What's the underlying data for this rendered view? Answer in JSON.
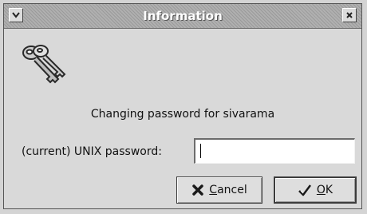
{
  "window": {
    "title": "Information",
    "menu_icon": "chevron-down-icon",
    "close_icon": "close-icon"
  },
  "dialog": {
    "icon": "keys-icon",
    "message": "Changing password for sivarama",
    "prompt_label": "(current) UNIX password:",
    "password_value": ""
  },
  "buttons": {
    "cancel_label": "Cancel",
    "cancel_icon": "cross-icon",
    "ok_label": "OK",
    "ok_icon": "checkmark-icon"
  },
  "colors": {
    "titlebar": "#a6a6a6",
    "dialog_bg": "#d9d9d9",
    "input_bg": "#ffffff"
  }
}
